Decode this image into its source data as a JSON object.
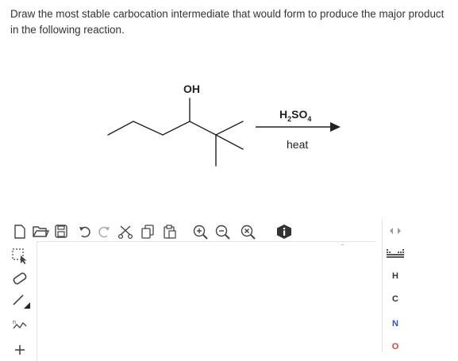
{
  "question": {
    "text": "Draw the most stable carbocation intermediate that would form to produce the major product in the following reaction."
  },
  "reaction": {
    "substituent_label": "OH",
    "reagent": {
      "h": "H",
      "sub1": "2",
      "so": "SO",
      "sub2": "4"
    },
    "condition": "heat"
  },
  "toolbar": {
    "icons": [
      "new-document-icon",
      "open-file-icon",
      "save-icon",
      "undo-icon",
      "redo-icon",
      "cut-icon",
      "copy-icon",
      "paste-icon",
      "zoom-in-icon",
      "zoom-out-icon",
      "clear-icon",
      "info-icon"
    ]
  },
  "left_toolbar": {
    "icons": [
      "select-lasso-icon",
      "eraser-icon",
      "single-bond-icon",
      "chain-tool-icon",
      "charge-plus-icon"
    ]
  },
  "elements": {
    "items": [
      "H",
      "C",
      "N",
      "O"
    ],
    "colors": {
      "H": "#333333",
      "C": "#333333",
      "N": "#3050c8",
      "O": "#e0403a"
    }
  },
  "colors": {
    "icon": "#444444",
    "border": "#e4e4e4"
  }
}
